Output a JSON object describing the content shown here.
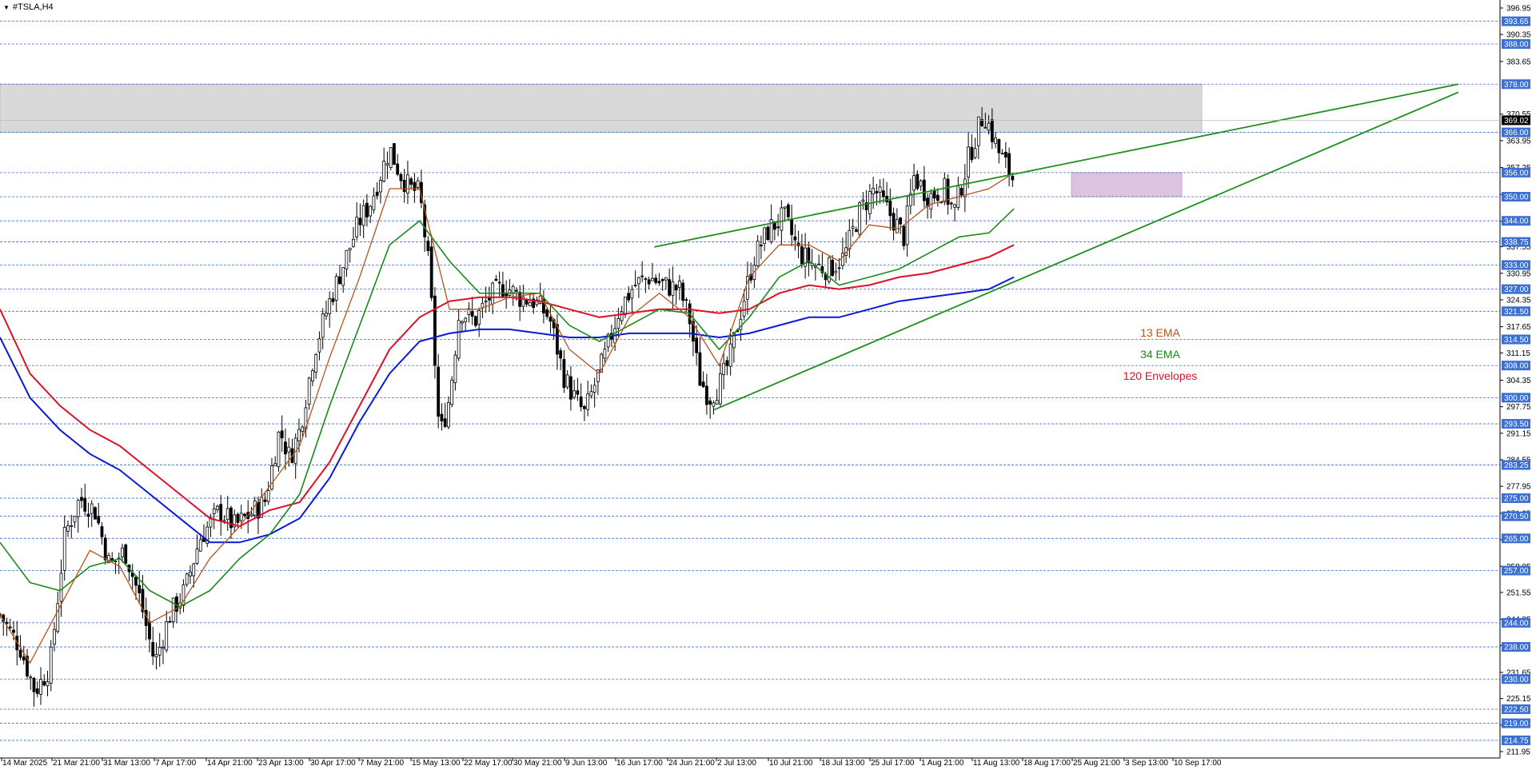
{
  "symbol_label": "#TSLA,H4",
  "colors": {
    "ema13": "#b5541e",
    "ema34": "#1a8a1a",
    "env120_red": "#e0102a",
    "env120_blue": "#0a1ad6",
    "trendline": "#1f8f1f",
    "level_line": "#3b6fd1",
    "badge_fill": "#3b6fd1",
    "grey_zone": "#d9d9d9",
    "purple_zone": "#dcc4e0",
    "candle": "#000000"
  },
  "legend": [
    {
      "label": "13 EMA",
      "color": "#b5541e"
    },
    {
      "label": "34 EMA",
      "color": "#1a8a1a"
    },
    {
      "label": "120 Envelopes",
      "color": "#e0102a"
    }
  ],
  "chart_data": {
    "type": "candlestick",
    "x_axis_labels": [
      "14 Mar 2025",
      "21 Mar 21:00",
      "31 Mar 13:00",
      "7 Apr 17:00",
      "14 Apr 21:00",
      "23 Apr 13:00",
      "30 Apr 17:00",
      "7 May 21:00",
      "15 May 13:00",
      "22 May 17:00",
      "30 May 21:00",
      "9 Jun 13:00",
      "16 Jun 17:00",
      "24 Jun 21:00",
      "2 Jul 13:00",
      "10 Jul 21:00",
      "18 Jul 13:00",
      "25 Jul 17:00",
      "1 Aug 21:00",
      "11 Aug 13:00",
      "18 Aug 17:00",
      "25 Aug 21:00",
      "3 Sep 13:00",
      "10 Sep 17:00"
    ],
    "y_axis_ticks": [
      "396.95",
      "390.35",
      "383.65",
      "370.55",
      "363.95",
      "357.25",
      "350.55",
      "343.85",
      "337.55",
      "330.95",
      "324.35",
      "317.65",
      "311.15",
      "304.35",
      "297.75",
      "291.15",
      "284.55",
      "277.95",
      "271.25",
      "264.65",
      "258.05",
      "251.55",
      "244.85",
      "238.35",
      "231.65",
      "225.15",
      "218.55",
      "211.95"
    ],
    "ylim": [
      211.95,
      396.95
    ],
    "levels": [
      "393.65",
      "388.00",
      "378.00",
      "366.00",
      "356.00",
      "350.00",
      "344.00",
      "338.75",
      "333.00",
      "327.00",
      "321.50",
      "314.50",
      "308.00",
      "300.00",
      "293.50",
      "283.25",
      "275.00",
      "270.50",
      "265.00",
      "257.00",
      "244.00",
      "238.00",
      "230.00",
      "222.50",
      "219.00",
      "214.75"
    ],
    "current_price": "369.02",
    "zones": [
      {
        "name": "resistance-zone",
        "from": 366.0,
        "to": 378.0
      },
      {
        "name": "consolidation-zone",
        "from": 350.0,
        "to": 356.0
      }
    ],
    "trendlines": [
      {
        "name": "wedge-upper",
        "points": [
          [
            131,
            337.5
          ],
          [
            292,
            378.0
          ]
        ]
      },
      {
        "name": "wedge-lower",
        "points": [
          [
            143,
            297.0
          ],
          [
            292,
            376.0
          ]
        ]
      }
    ],
    "close_path": [
      [
        0,
        246
      ],
      [
        4,
        238
      ],
      [
        7,
        227
      ],
      [
        10,
        233
      ],
      [
        13,
        266
      ],
      [
        16,
        275
      ],
      [
        19,
        272
      ],
      [
        22,
        258
      ],
      [
        25,
        262
      ],
      [
        28,
        250
      ],
      [
        31,
        234
      ],
      [
        34,
        246
      ],
      [
        37,
        252
      ],
      [
        40,
        265
      ],
      [
        44,
        272
      ],
      [
        47,
        268
      ],
      [
        50,
        271
      ],
      [
        53,
        274
      ],
      [
        56,
        292
      ],
      [
        58,
        285
      ],
      [
        60,
        292
      ],
      [
        63,
        312
      ],
      [
        66,
        324
      ],
      [
        69,
        334
      ],
      [
        72,
        344
      ],
      [
        74,
        348
      ],
      [
        76,
        355
      ],
      [
        78,
        362
      ],
      [
        80,
        356
      ],
      [
        82,
        352
      ],
      [
        84,
        351
      ],
      [
        86,
        331
      ],
      [
        88,
        290
      ],
      [
        90,
        300
      ],
      [
        92,
        322
      ],
      [
        95,
        319
      ],
      [
        98,
        325
      ],
      [
        101,
        328
      ],
      [
        104,
        325
      ],
      [
        107,
        324
      ],
      [
        110,
        320
      ],
      [
        113,
        305
      ],
      [
        115,
        300
      ],
      [
        117,
        296
      ],
      [
        119,
        303
      ],
      [
        121,
        310
      ],
      [
        124,
        322
      ],
      [
        127,
        328
      ],
      [
        130,
        330
      ],
      [
        133,
        328
      ],
      [
        136,
        327
      ],
      [
        138,
        320
      ],
      [
        140,
        305
      ],
      [
        142,
        300
      ],
      [
        144,
        303
      ],
      [
        146,
        309
      ],
      [
        148,
        320
      ],
      [
        151,
        335
      ],
      [
        154,
        342
      ],
      [
        157,
        345
      ],
      [
        160,
        336
      ],
      [
        163,
        333
      ],
      [
        166,
        332
      ],
      [
        169,
        335
      ],
      [
        172,
        346
      ],
      [
        175,
        352
      ],
      [
        178,
        346
      ],
      [
        181,
        340
      ],
      [
        183,
        355
      ],
      [
        186,
        350
      ],
      [
        189,
        352
      ],
      [
        191,
        346
      ],
      [
        194,
        360
      ],
      [
        197,
        371
      ],
      [
        200,
        361
      ],
      [
        203,
        354
      ]
    ],
    "ema13_path": [
      [
        0,
        246
      ],
      [
        6,
        234
      ],
      [
        12,
        248
      ],
      [
        18,
        262
      ],
      [
        24,
        258
      ],
      [
        30,
        244
      ],
      [
        36,
        248
      ],
      [
        42,
        260
      ],
      [
        48,
        268
      ],
      [
        54,
        278
      ],
      [
        60,
        288
      ],
      [
        66,
        310
      ],
      [
        72,
        330
      ],
      [
        78,
        352
      ],
      [
        84,
        352
      ],
      [
        90,
        322
      ],
      [
        96,
        322
      ],
      [
        102,
        325
      ],
      [
        108,
        326
      ],
      [
        114,
        312
      ],
      [
        120,
        306
      ],
      [
        126,
        320
      ],
      [
        132,
        326
      ],
      [
        138,
        320
      ],
      [
        144,
        308
      ],
      [
        150,
        330
      ],
      [
        156,
        338
      ],
      [
        162,
        338
      ],
      [
        168,
        334
      ],
      [
        174,
        343
      ],
      [
        180,
        342
      ],
      [
        186,
        348
      ],
      [
        192,
        350
      ],
      [
        198,
        352
      ],
      [
        203,
        356
      ]
    ],
    "ema34_path": [
      [
        0,
        264
      ],
      [
        6,
        254
      ],
      [
        12,
        252
      ],
      [
        18,
        258
      ],
      [
        24,
        260
      ],
      [
        30,
        252
      ],
      [
        36,
        248
      ],
      [
        42,
        252
      ],
      [
        48,
        260
      ],
      [
        54,
        266
      ],
      [
        60,
        276
      ],
      [
        66,
        298
      ],
      [
        72,
        318
      ],
      [
        78,
        338
      ],
      [
        84,
        344
      ],
      [
        90,
        334
      ],
      [
        96,
        326
      ],
      [
        102,
        326
      ],
      [
        108,
        326
      ],
      [
        114,
        318
      ],
      [
        120,
        314
      ],
      [
        126,
        318
      ],
      [
        132,
        322
      ],
      [
        138,
        321
      ],
      [
        144,
        312
      ],
      [
        150,
        320
      ],
      [
        156,
        330
      ],
      [
        162,
        334
      ],
      [
        168,
        328
      ],
      [
        174,
        330
      ],
      [
        180,
        332
      ],
      [
        186,
        336
      ],
      [
        192,
        340
      ],
      [
        198,
        341
      ],
      [
        203,
        347
      ]
    ],
    "env_red_path": [
      [
        0,
        322
      ],
      [
        6,
        306
      ],
      [
        12,
        298
      ],
      [
        18,
        292
      ],
      [
        24,
        288
      ],
      [
        30,
        282
      ],
      [
        36,
        276
      ],
      [
        42,
        270
      ],
      [
        48,
        268
      ],
      [
        54,
        272
      ],
      [
        60,
        274
      ],
      [
        66,
        284
      ],
      [
        72,
        298
      ],
      [
        78,
        312
      ],
      [
        84,
        320
      ],
      [
        90,
        324
      ],
      [
        96,
        325
      ],
      [
        102,
        325
      ],
      [
        108,
        324
      ],
      [
        114,
        322
      ],
      [
        120,
        320
      ],
      [
        126,
        321
      ],
      [
        132,
        322
      ],
      [
        138,
        322
      ],
      [
        144,
        321
      ],
      [
        150,
        322
      ],
      [
        156,
        326
      ],
      [
        162,
        328
      ],
      [
        168,
        327
      ],
      [
        174,
        328
      ],
      [
        180,
        330
      ],
      [
        186,
        331
      ],
      [
        192,
        333
      ],
      [
        198,
        335
      ],
      [
        203,
        338
      ]
    ],
    "env_blue_path": [
      [
        0,
        315
      ],
      [
        6,
        300
      ],
      [
        12,
        292
      ],
      [
        18,
        286
      ],
      [
        24,
        282
      ],
      [
        30,
        276
      ],
      [
        36,
        270
      ],
      [
        42,
        264
      ],
      [
        48,
        264
      ],
      [
        54,
        266
      ],
      [
        60,
        270
      ],
      [
        66,
        280
      ],
      [
        72,
        294
      ],
      [
        78,
        306
      ],
      [
        84,
        314
      ],
      [
        90,
        316
      ],
      [
        96,
        317
      ],
      [
        102,
        317
      ],
      [
        108,
        316
      ],
      [
        114,
        315
      ],
      [
        120,
        315
      ],
      [
        126,
        316
      ],
      [
        132,
        316
      ],
      [
        138,
        316
      ],
      [
        144,
        315
      ],
      [
        150,
        316
      ],
      [
        156,
        318
      ],
      [
        162,
        320
      ],
      [
        168,
        320
      ],
      [
        174,
        322
      ],
      [
        180,
        324
      ],
      [
        186,
        325
      ],
      [
        192,
        326
      ],
      [
        198,
        327
      ],
      [
        203,
        330
      ]
    ]
  }
}
